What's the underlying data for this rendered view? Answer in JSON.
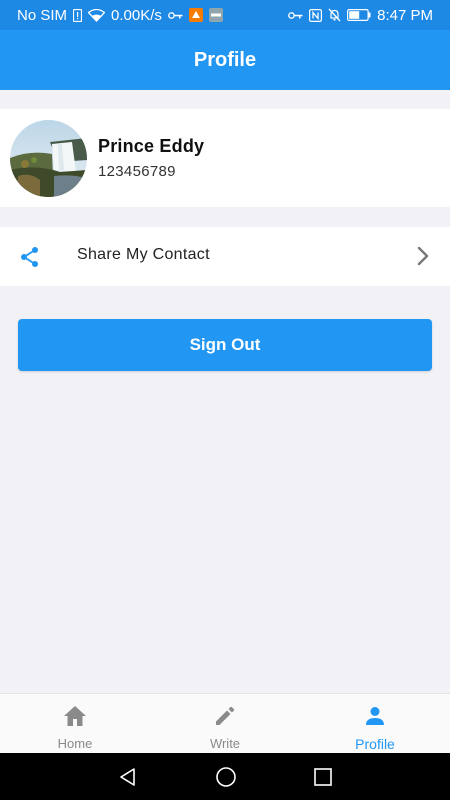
{
  "status_bar": {
    "carrier": "No SIM",
    "speed": "0.00K/s",
    "time": "8:47 PM",
    "icons": [
      "sim-alert-icon",
      "wifi-icon",
      "vpn-key-icon",
      "app-notification-icon",
      "vpn-badge-icon",
      "key-icon",
      "nfc-icon",
      "mute-icon",
      "battery-icon"
    ]
  },
  "app_bar": {
    "title": "Profile"
  },
  "profile": {
    "name": "Prince Eddy",
    "phone": "123456789"
  },
  "share_row": {
    "label": "Share My Contact",
    "icon": "share-icon"
  },
  "sign_out": {
    "label": "Sign Out"
  },
  "bottom_nav": {
    "items": [
      {
        "label": "Home",
        "icon": "home-icon",
        "active": false
      },
      {
        "label": "Write",
        "icon": "pencil-icon",
        "active": false
      },
      {
        "label": "Profile",
        "icon": "person-icon",
        "active": true
      }
    ]
  },
  "colors": {
    "primary": "#2196f3",
    "status_bar": "#1e88e5",
    "background": "#f2f1f6",
    "nav_inactive": "#8a8a8a"
  }
}
